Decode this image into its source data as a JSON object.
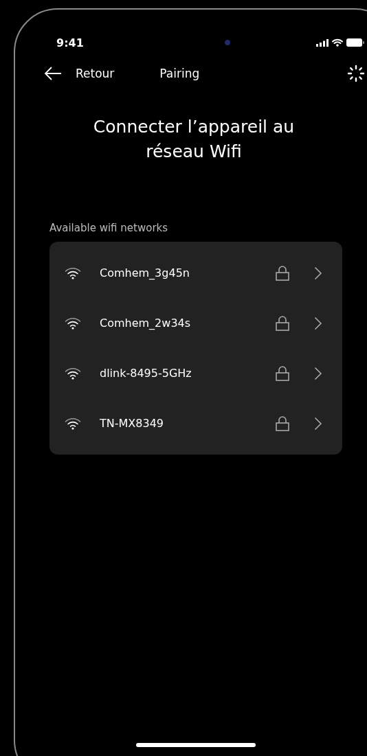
{
  "status_bar": {
    "time": "9:41"
  },
  "nav": {
    "back_label": "Retour",
    "title": "Pairing"
  },
  "heading": "Connecter l’appareil au réseau Wifi",
  "section_label": "Available wifi networks",
  "networks": [
    {
      "name": "Comhem_3g45n",
      "locked": true
    },
    {
      "name": "Comhem_2w34s",
      "locked": true
    },
    {
      "name": "dlink-8495-5GHz",
      "locked": true
    },
    {
      "name": "TN-MX8349",
      "locked": true
    }
  ]
}
